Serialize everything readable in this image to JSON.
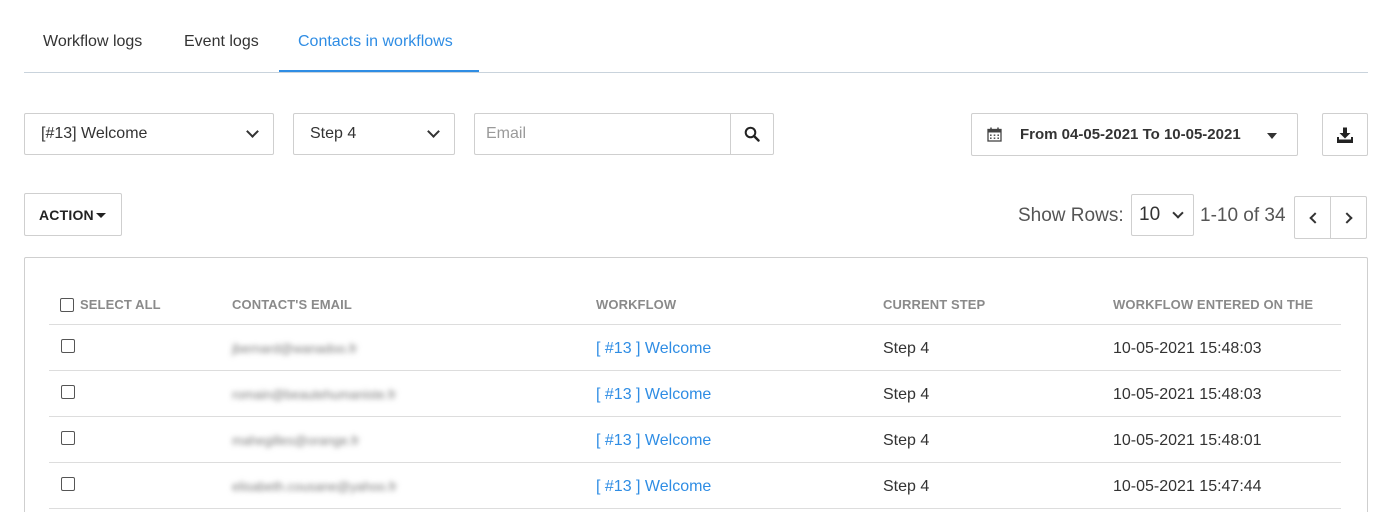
{
  "tabs": [
    {
      "label": "Workflow logs",
      "active": false
    },
    {
      "label": "Event logs",
      "active": false
    },
    {
      "label": "Contacts in workflows",
      "active": true
    }
  ],
  "filters": {
    "workflow_select": "[#13] Welcome",
    "step_select": "Step 4",
    "email_placeholder": "Email",
    "email_value": "",
    "date_range_label": "From 04-05-2021 To 10-05-2021"
  },
  "icons": {
    "search": "search-icon",
    "calendar": "calendar-icon",
    "download": "download-icon"
  },
  "toolbar": {
    "action_label": "ACTION",
    "show_rows_label": "Show Rows:",
    "rows_per_page": "10",
    "range_label": "1-10 of 34"
  },
  "table": {
    "headers": {
      "select_all": "SELECT ALL",
      "email": "CONTACT'S EMAIL",
      "workflow": "WORKFLOW",
      "current_step": "CURRENT STEP",
      "entered_on": "WORKFLOW ENTERED ON THE"
    },
    "rows": [
      {
        "email": "jbernard@wanadoo.fr",
        "workflow": "[ #13 ] Welcome",
        "step": "Step 4",
        "entered": "10-05-2021 15:48:03"
      },
      {
        "email": "romain@beautehumaniste.fr",
        "workflow": "[ #13 ] Welcome",
        "step": "Step 4",
        "entered": "10-05-2021 15:48:03"
      },
      {
        "email": "mahegilles@orange.fr",
        "workflow": "[ #13 ] Welcome",
        "step": "Step 4",
        "entered": "10-05-2021 15:48:01"
      },
      {
        "email": "elisabeth.cousane@yahoo.fr",
        "workflow": "[ #13 ] Welcome",
        "step": "Step 4",
        "entered": "10-05-2021 15:47:44"
      }
    ]
  },
  "colors": {
    "accent": "#2f8de4",
    "border": "#cfcfcf",
    "header_text": "#8a8a8a"
  }
}
